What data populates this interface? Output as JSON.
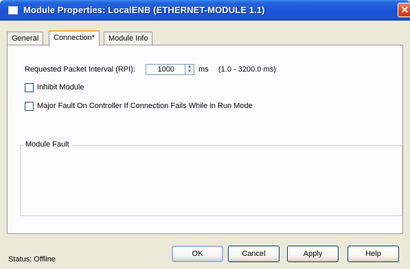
{
  "window": {
    "title": "Module Properties: LocalENB (ETHERNET-MODULE 1.1)",
    "close_glyph": "✕"
  },
  "tabs": [
    {
      "label": "General",
      "active": false
    },
    {
      "label": "Connection*",
      "active": true
    },
    {
      "label": "Module Info",
      "active": false
    }
  ],
  "connection": {
    "rpi_label": "Requested Packet Interval (RPI):",
    "rpi_value": "1000",
    "rpi_unit": "ms",
    "rpi_range": "(1.0 - 3200.0 ms)",
    "inhibit_label": "Inhibit Module",
    "inhibit_checked": false,
    "major_fault_label": "Major Fault On Controller If Connection Fails While in Run Mode",
    "major_fault_checked": false
  },
  "module_fault": {
    "title": "Module Fault"
  },
  "footer": {
    "status_text": "Status:  Offline",
    "ok_label": "OK",
    "cancel_label": "Cancel",
    "apply_label": "Apply",
    "help_label": "Help"
  },
  "colors": {
    "titlebar": "#2567df",
    "dialog_bg": "#ece9d8",
    "active_tab_accent": "#f6b030"
  }
}
